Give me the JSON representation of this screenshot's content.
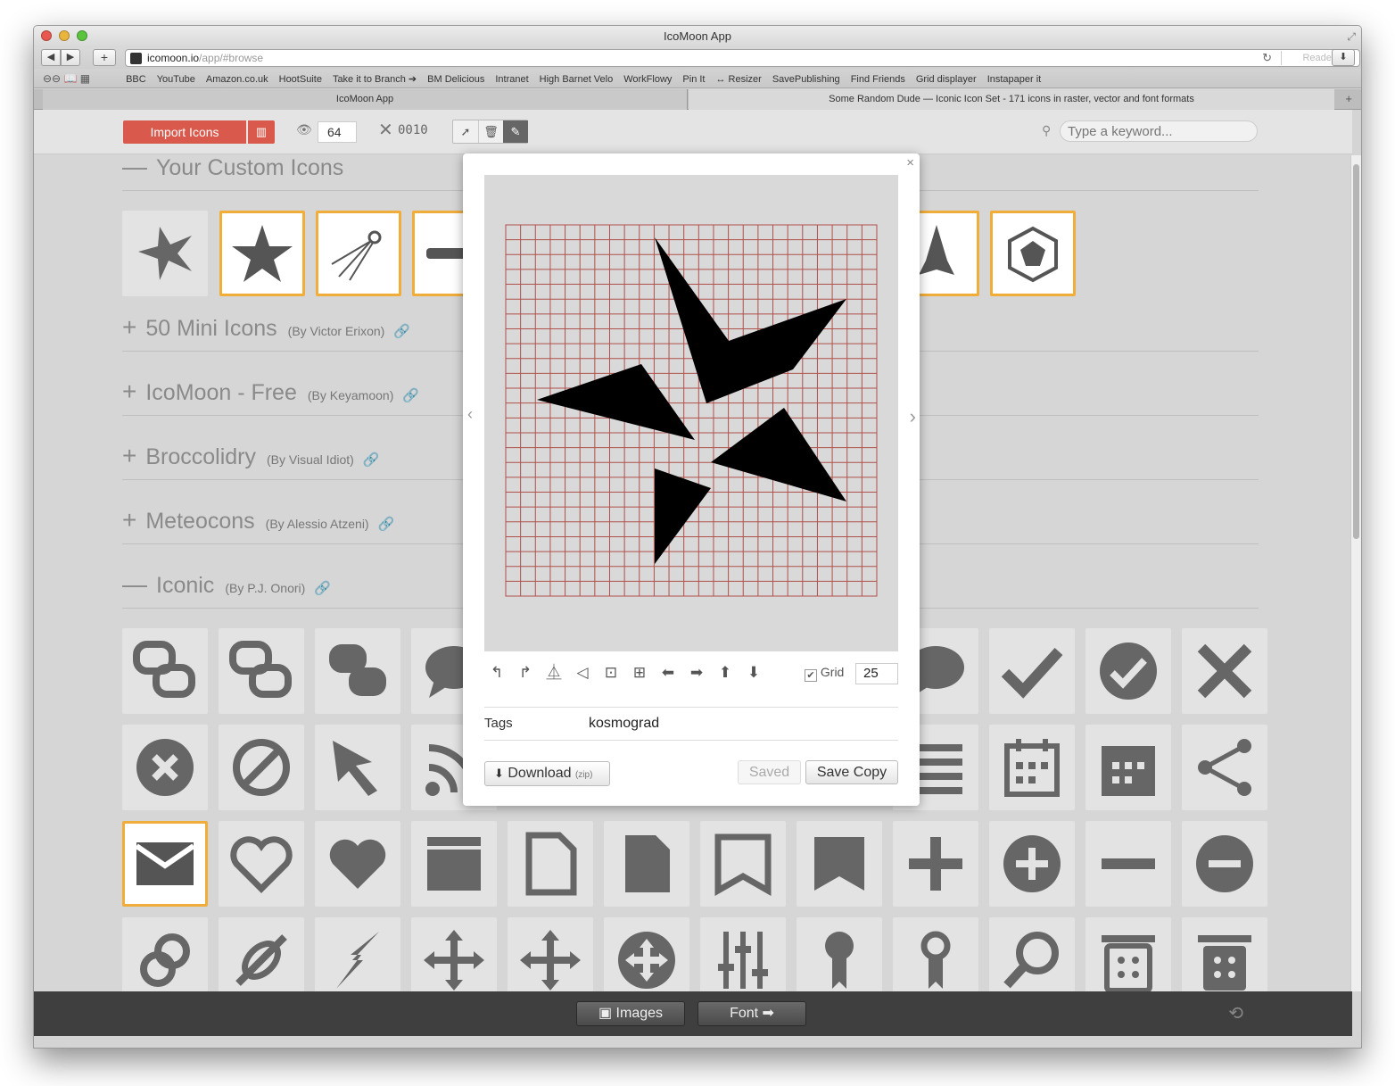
{
  "window": {
    "title": "IcoMoon App"
  },
  "browser": {
    "url_host": "icomoon.io",
    "url_path": "/app/#browse",
    "reader_label": "Reader",
    "back_label": "◀",
    "forward_label": "▶",
    "add_label": "+",
    "bookmarks": [
      "BBC",
      "YouTube",
      "Amazon.co.uk",
      "HootSuite",
      "Take it to Branch ➔",
      "BM Delicious",
      "Intranet",
      "High Barnet Velo",
      "WorkFlowy",
      "Pin It",
      "↔ Resizer",
      "SavePublishing",
      "Find Friends",
      "Grid displayer",
      "Instapaper it"
    ],
    "tabs": [
      "IcoMoon App",
      "Some Random Dude — Iconic Icon Set - 171 icons in raster, vector and font formats"
    ]
  },
  "toolbar": {
    "import_label": "Import Icons",
    "size_value": "64",
    "code_value": "0010",
    "search_placeholder": "Type a keyword..."
  },
  "sections": [
    {
      "expand": "—",
      "title": "Your Custom Icons",
      "author": ""
    },
    {
      "expand": "+",
      "title": "50 Mini Icons",
      "author": "(By Victor Erixon)"
    },
    {
      "expand": "+",
      "title": "IcoMoon - Free",
      "author": "(By Keyamoon)"
    },
    {
      "expand": "+",
      "title": "Broccolidry",
      "author": "(By Visual Idiot)"
    },
    {
      "expand": "+",
      "title": "Meteocons",
      "author": "(By Alessio Atzeni)"
    },
    {
      "expand": "—",
      "title": "Iconic",
      "author": "(By P.J. Onori)"
    }
  ],
  "editor": {
    "grid_label": "Grid",
    "grid_value": "25",
    "tags_label": "Tags",
    "tags_value": "kosmograd",
    "download_label": "Download",
    "download_note": "(zip)",
    "saved_label": "Saved",
    "save_copy_label": "Save Copy"
  },
  "bottombar": {
    "images_label": "Images",
    "font_label": "Font"
  },
  "colors": {
    "accent": "#d9594c",
    "selected_border": "#f1ad3a",
    "grid_line": "#b0504a"
  }
}
